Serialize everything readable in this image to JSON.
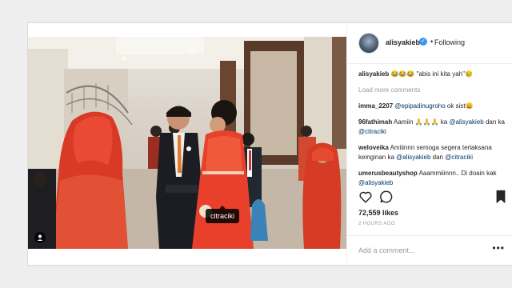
{
  "post": {
    "photo_tag": "citraciki",
    "username": "alisyakieb",
    "follow_status": "Following",
    "separator": "•",
    "caption_user": "alisyakieb",
    "caption_text": " 😂😂😂 \"abis ini kita yah\"😢",
    "load_more": "Load more comments",
    "comments": [
      {
        "user": "imma_2207",
        "parts": [
          " ",
          "@epipadinugroho",
          " ok sist😀"
        ]
      },
      {
        "user": "96fathimah",
        "parts": [
          " Aamiin 🙏🙏🙏 ka ",
          "@alisyakieb",
          " dan ka ",
          "@citraciki"
        ]
      },
      {
        "user": "weloveika",
        "parts": [
          " Amiiinnn semoga segera terlaksana keinginan ka ",
          "@alisyakieb",
          " dan ",
          "@citraciki"
        ]
      },
      {
        "user": "umerusbeautyshop",
        "parts": [
          " Aaammiiinnn.. Di doain kak ",
          "@alisyakieb"
        ]
      }
    ],
    "likes": "72,559 likes",
    "timestamp": "2 HOURS AGO",
    "add_comment_placeholder": "Add a comment...",
    "more_options": "•••"
  },
  "colors": {
    "page_bg": "#eeeeee",
    "card_border": "#dbdbdb",
    "verified_blue": "#3897f0",
    "mention_blue": "#003569",
    "dress_red": "#e8402a"
  },
  "icons": [
    "heart-icon",
    "comment-icon",
    "bookmark-icon",
    "verified-badge-icon",
    "user-tag-icon"
  ]
}
